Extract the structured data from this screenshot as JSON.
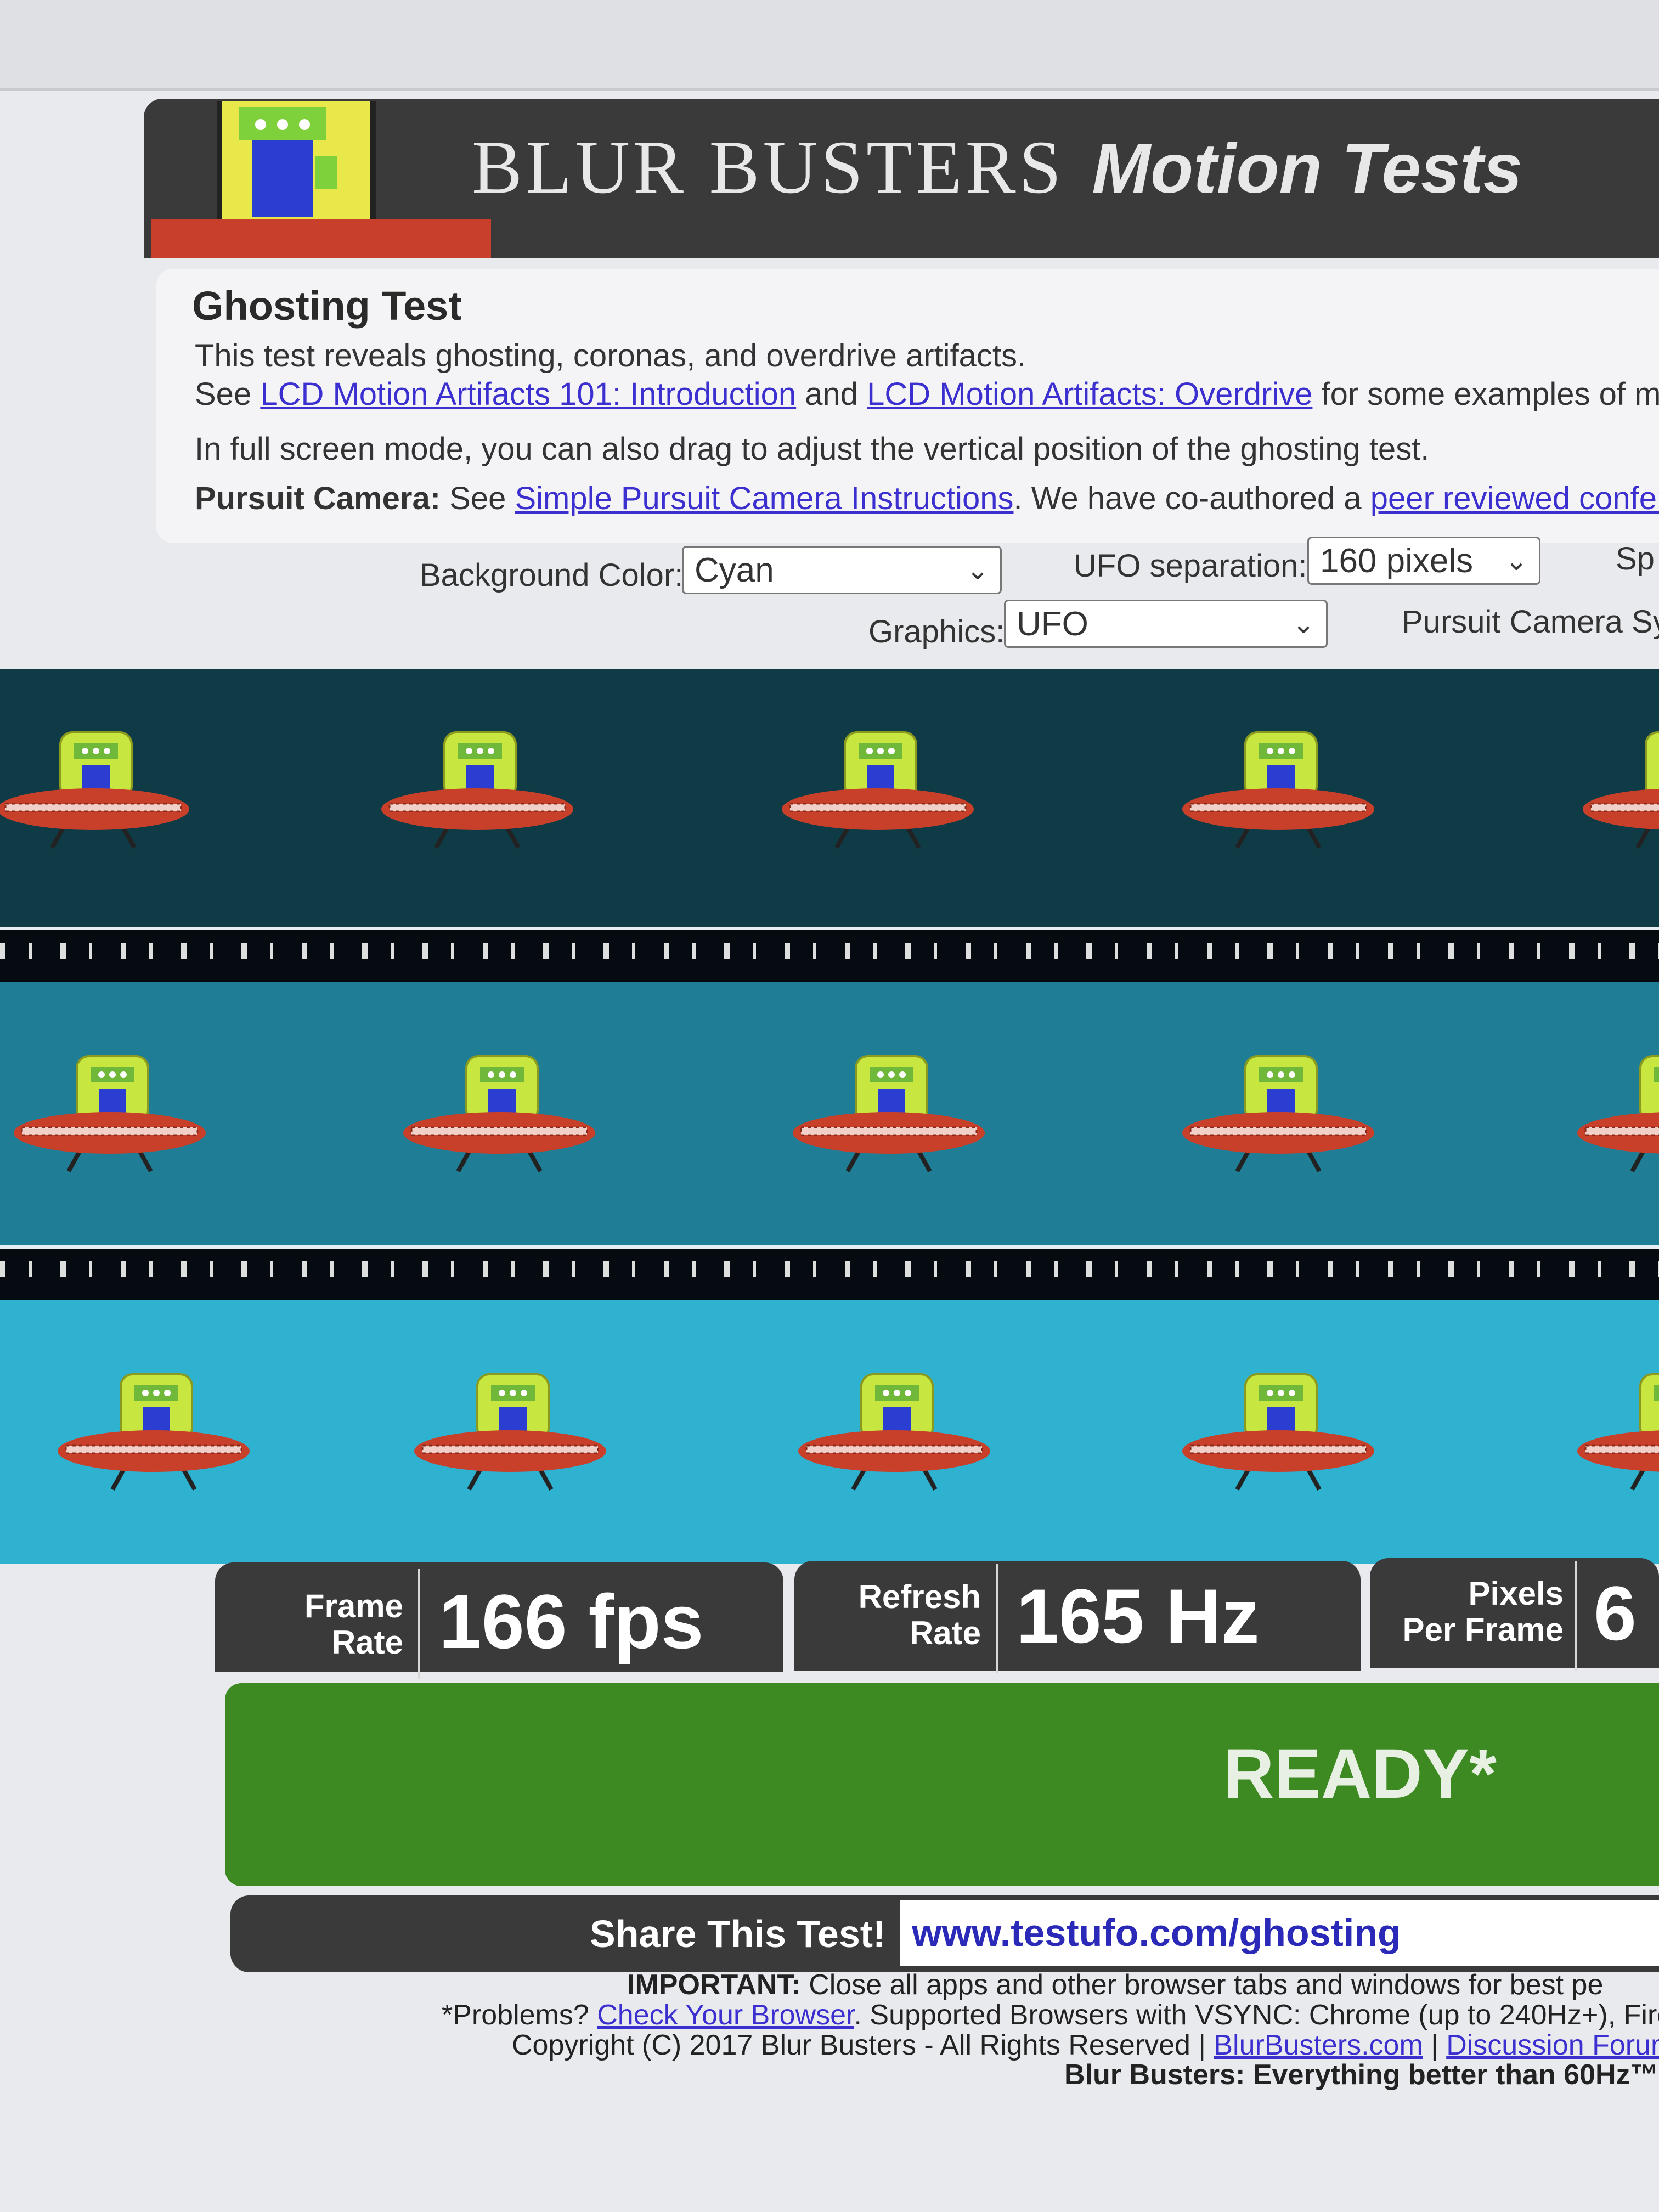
{
  "banner": {
    "title": "BLUR BUSTERS",
    "subtitle": "Motion Tests",
    "logo_icon": "alien-ufo-logo-icon"
  },
  "info": {
    "title": "Ghosting Test",
    "line1": "This test reveals ghosting, coronas, and overdrive artifacts.",
    "line2_prefix": "See ",
    "line2_link1": "LCD Motion Artifacts 101: Introduction",
    "line2_mid": " and ",
    "line2_link2": "LCD Motion Artifacts: Overdrive",
    "line2_suffix": " for some examples of motic",
    "line3": "In full screen mode, you can also drag to adjust the vertical position of the ghosting test.",
    "line4_bold": "Pursuit Camera:",
    "line4_prefix": " See ",
    "line4_link1": "Simple Pursuit Camera Instructions",
    "line4_mid": ". We have co-authored a ",
    "line4_link2": "peer reviewed conferen"
  },
  "controls": {
    "background_label": "Background Color:",
    "background_value": "Cyan",
    "separation_label": "UFO separation:",
    "separation_value": "160 pixels",
    "speed_label": "Sp",
    "graphics_label": "Graphics:",
    "graphics_value": "UFO",
    "pursuit_label": "Pursuit Camera Sy"
  },
  "bands": [
    {
      "color": "#0e3b46"
    },
    {
      "color": "#1f7e96"
    },
    {
      "color": "#2fb1d0"
    }
  ],
  "ufo_icon": "ufo-alien-icon",
  "status": {
    "frame_label1": "Frame",
    "frame_label2": "Rate",
    "frame_value": "166 fps",
    "refresh_label1": "Refresh",
    "refresh_label2": "Rate",
    "refresh_value": "165 Hz",
    "ppf_label1": "Pixels",
    "ppf_label2": "Per Frame",
    "ppf_value": "6",
    "ready": "READY*"
  },
  "share": {
    "label": "Share This Test!",
    "url": "www.testufo.com/ghosting"
  },
  "footer": {
    "important_bold": "IMPORTANT:",
    "important_text": " Close all apps and other browser tabs and windows for best pe",
    "problems_prefix": "*Problems? ",
    "problems_link": "Check Your Browser",
    "problems_suffix": ". Supported Browsers with VSYNC: Chrome (up to 240Hz+), Fire",
    "copyright": "Copyright (C) 2017 Blur Busters - All Rights Reserved | ",
    "link_bb": "BlurBusters.com",
    "sep": " | ",
    "link_forum": "Discussion Forum",
    "tagline": "Blur Busters: Everything better than 60Hz™"
  }
}
